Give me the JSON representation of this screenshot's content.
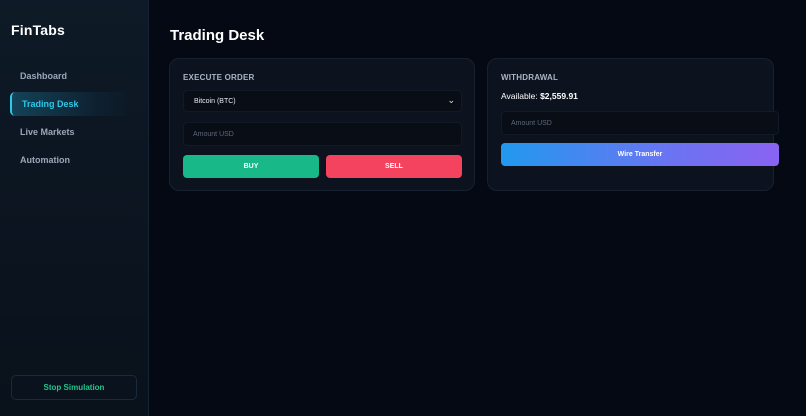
{
  "sidebar": {
    "brand": "FinTabs",
    "items": [
      {
        "label": "Dashboard"
      },
      {
        "label": "Trading Desk"
      },
      {
        "label": "Live Markets"
      },
      {
        "label": "Automation"
      }
    ],
    "active_index": 1,
    "stop_button": "Stop Simulation"
  },
  "main": {
    "title": "Trading Desk",
    "order": {
      "heading": "EXECUTE ORDER",
      "asset_selected": "Bitcoin (BTC)",
      "amount_placeholder": "Amount USD",
      "buy_label": "BUY",
      "sell_label": "SELL"
    },
    "withdrawal": {
      "heading": "WITHDRAWAL",
      "available_label": "Available:",
      "available_value": "$2,559.91",
      "amount_placeholder": "Amount USD",
      "wire_label": "Wire Transfer"
    }
  },
  "icons": {
    "select_chevron": "chevron-down-icon"
  },
  "colors": {
    "accent": "#2ec8e8",
    "buy": "#18b889",
    "sell": "#f3435f",
    "stop_text": "#22c58b",
    "wire_gradient_start": "#2299ee",
    "wire_gradient_end": "#8a63f3"
  }
}
